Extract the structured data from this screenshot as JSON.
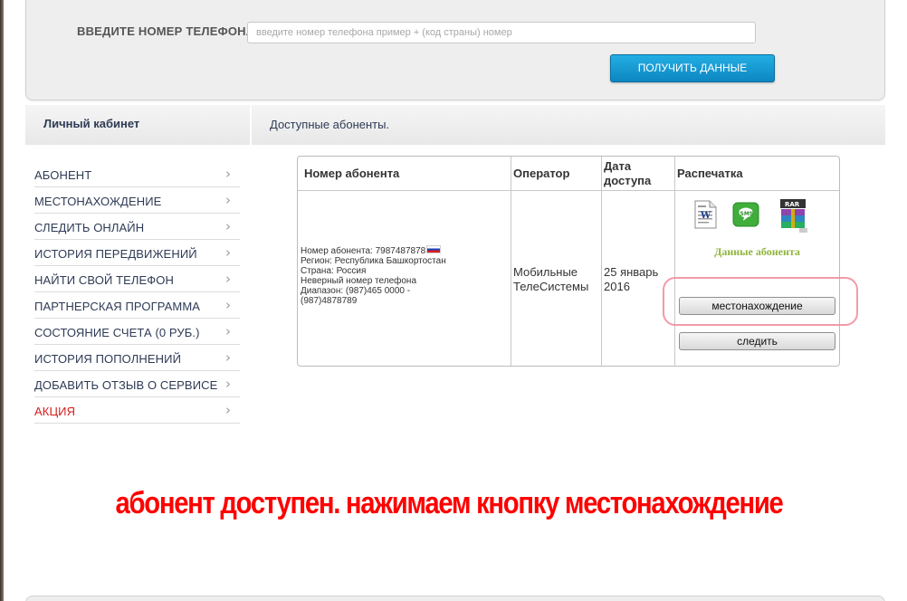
{
  "form": {
    "phone_label": "ВВЕДИТЕ НОМЕР ТЕЛЕФОНА:",
    "phone_placeholder": "введите номер телефона пример + (код страны) номер",
    "phone_value": "",
    "get_data_button": "ПОЛУЧИТЬ ДАННЫЕ"
  },
  "sidebar": {
    "title": "Личный кабинет",
    "items": [
      {
        "label": "АБОНЕНТ"
      },
      {
        "label": "МЕСТОНАХОЖДЕНИЕ"
      },
      {
        "label": "СЛЕДИТЬ ОНЛАЙН"
      },
      {
        "label": "ИСТОРИЯ ПЕРЕДВИЖЕНИЙ"
      },
      {
        "label": "НАЙТИ СВОЙ ТЕЛЕФОН"
      },
      {
        "label": "ПАРТНЕРСКАЯ ПРОГРАММА"
      },
      {
        "label": "СОСТОЯНИЕ СЧЕТА (0 РУБ.)"
      },
      {
        "label": "ИСТОРИЯ ПОПОЛНЕНИЙ"
      },
      {
        "label": "ДОБАВИТЬ ОТЗЫВ О СЕРВИСЕ"
      },
      {
        "label": "АКЦИЯ"
      }
    ]
  },
  "content": {
    "title": "Доступные абоненты.",
    "table": {
      "headers": {
        "number": "Номер абонента",
        "operator": "Оператор",
        "date_line1": "Дата",
        "date_line2": "доступа",
        "print": "Распечатка"
      },
      "row": {
        "number_line": "Номер абонента: 7987487878",
        "region": "Регион: Республика Башкортостан",
        "country": "Страна: Россия",
        "invalid": "Неверный номер телефона",
        "range_line1": "Диапазон: (987)465 0000 -",
        "range_line2": "(987)4878789",
        "operator_line1": "Мобильные",
        "operator_line2": "ТелеСистемы",
        "date_line1": "25 январь",
        "date_line2": "2016",
        "print_icons": [
          "word-document-icon",
          "sms-icon",
          "rar-archive-icon"
        ],
        "print_label": "Данные абонента",
        "location_button": "местонахождение",
        "track_button": "следить"
      }
    }
  },
  "instruction": "абонент доступен. нажимаем кнопку местонахождение",
  "colors": {
    "accent_blue": "#1a9bd6",
    "menu_text": "#2e3b55",
    "promo_red": "#d81c1c",
    "instruction_red": "#ff0000",
    "data_green": "#8fb33b",
    "highlight_pink": "#f08a9a"
  }
}
